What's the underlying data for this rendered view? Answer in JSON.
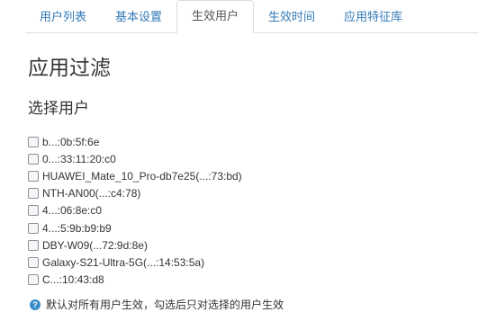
{
  "tabs": [
    {
      "label": "用户列表"
    },
    {
      "label": "基本设置"
    },
    {
      "label": "生效用户",
      "active": true
    },
    {
      "label": "生效时间"
    },
    {
      "label": "应用特征库"
    }
  ],
  "page_title": "应用过滤",
  "section_title": "选择用户",
  "users": [
    {
      "label": "b...:0b:5f:6e",
      "checked": false
    },
    {
      "label": "0...:33:11:20:c0",
      "checked": false
    },
    {
      "label": "HUAWEI_Mate_10_Pro-db7e25(...:73:bd)",
      "checked": false
    },
    {
      "label": "NTH-AN00(...:c4:78)",
      "checked": false
    },
    {
      "label": "4...:06:8e:c0",
      "checked": false
    },
    {
      "label": "4...:5:9b:b9:b9",
      "checked": false
    },
    {
      "label": "DBY-W09(...72:9d:8e)",
      "checked": false
    },
    {
      "label": "Galaxy-S21-Ultra-5G(...:14:53:5a)",
      "checked": false
    },
    {
      "label": "C...:10:43:d8",
      "checked": false
    }
  ],
  "hint": {
    "icon": "help-icon",
    "text": "默认对所有用户生效，勾选后只对选择的用户生效"
  },
  "colors": {
    "tab_link": "#337ab7",
    "tab_active": "#555555",
    "help_icon": "#3c8dcc"
  }
}
